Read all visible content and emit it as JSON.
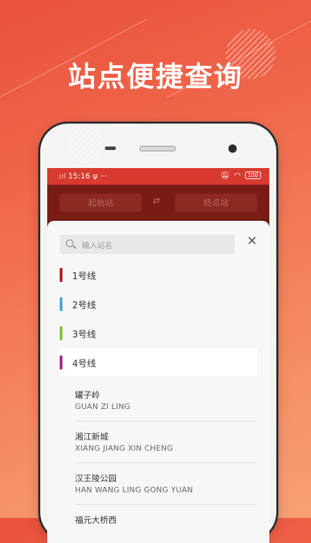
{
  "headline": "站点便捷查询",
  "status": {
    "time": "15:16",
    "usb": "ψ",
    "more": "···",
    "battery": "100"
  },
  "topbar": {
    "start_label": "起始站",
    "end_label": "终点站",
    "swap": "⇄"
  },
  "search": {
    "placeholder": "输入站名"
  },
  "close": "✕",
  "lines": [
    {
      "label": "1号线",
      "color": "#b81c22"
    },
    {
      "label": "2号线",
      "color": "#4ea8d6"
    },
    {
      "label": "3号线",
      "color": "#86c23a"
    },
    {
      "label": "4号线",
      "color": "#a62a8c"
    }
  ],
  "stations": [
    {
      "name": "罐子岭",
      "pinyin": "GUAN ZI LING"
    },
    {
      "name": "湘江新城",
      "pinyin": "XIANG JIANG XIN CHENG"
    },
    {
      "name": "汉王陵公园",
      "pinyin": "HAN WANG LING GONG YUAN"
    },
    {
      "name": "福元大桥西",
      "pinyin": ""
    }
  ]
}
